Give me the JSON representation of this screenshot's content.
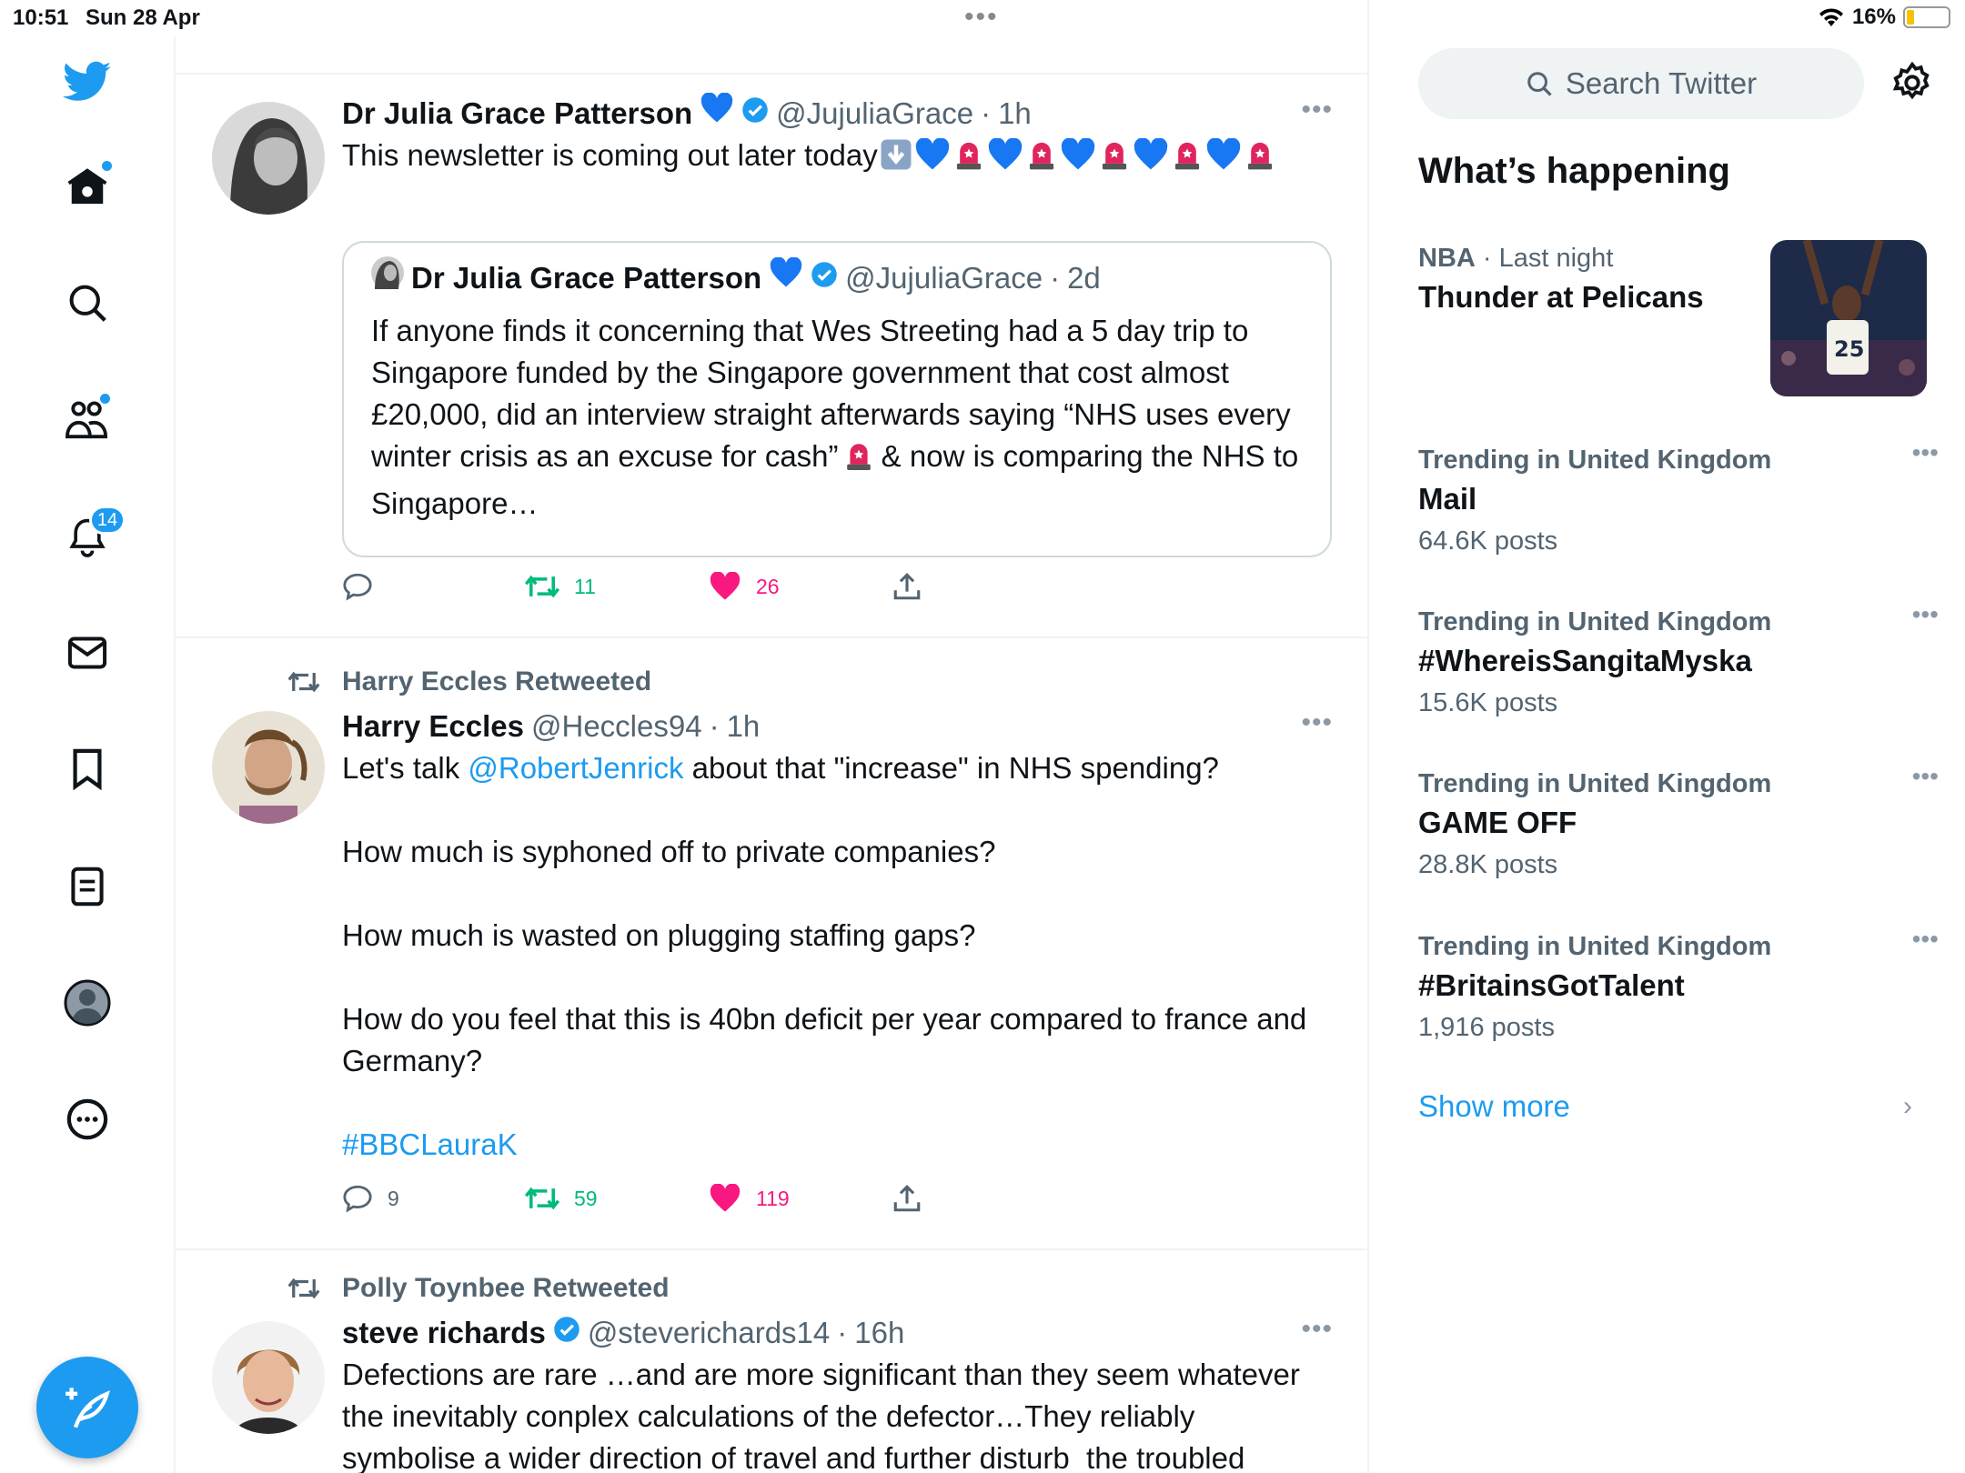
{
  "status": {
    "time": "10:51",
    "date": "Sun 28 Apr",
    "battery": "16%"
  },
  "rail": {
    "notifications_badge": "14"
  },
  "tweets": [
    {
      "name": "Dr Julia Grace Patterson",
      "handle": "@JujuliaGrace",
      "time": "1h",
      "text": "This newsletter is coming out later today",
      "quote": {
        "name": "Dr Julia Grace Patterson",
        "handle": "@JujuliaGrace",
        "time": "2d",
        "text_a": "If anyone finds it concerning that Wes Streeting had a 5 day trip to Singapore funded by the Singapore government that cost almost £20,000, did an interview straight afterwards saying “NHS uses every winter crisis as an excuse for cash”",
        "text_b": " & now is comparing the NHS to Singapore…"
      },
      "replies": "",
      "retweets": "11",
      "likes": "26"
    },
    {
      "retweeted_by": "Harry Eccles Retweeted",
      "name": "Harry Eccles",
      "handle": "@Heccles94",
      "time": "1h",
      "text_pre": "Let's talk ",
      "mention": "@RobertJenrick",
      "text_post": " about that \"increase\" in NHS spending?\n\nHow much is syphoned off to private companies?\n\nHow much is wasted on plugging staffing gaps?\n\nHow do you feel that this is 40bn deficit per year compared to france and Germany?\n\n",
      "hashtag": "#BBCLauraK",
      "replies": "9",
      "retweets": "59",
      "likes": "119"
    },
    {
      "retweeted_by": "Polly Toynbee Retweeted",
      "name": "steve richards",
      "handle": "@steverichards14",
      "time": "16h",
      "text": "Defections are rare …and are more significant than they seem whatever the inevitably conplex calculations of the defector…They reliably symbolise a wider direction of travel and further disturb  the troubled"
    }
  ],
  "sidebar": {
    "search_placeholder": "Search Twitter",
    "title": "What’s happening",
    "trends": [
      {
        "context": "NBA",
        "context_extra": " · Last night",
        "topic": "Thunder at Pelicans",
        "count": ""
      },
      {
        "context": "Trending in United Kingdom",
        "topic": "Mail",
        "count": "64.6K posts"
      },
      {
        "context": "Trending in United Kingdom",
        "topic": "#WhereisSangitaMyska",
        "count": "15.6K posts"
      },
      {
        "context": "Trending in United Kingdom",
        "topic": "GAME OFF",
        "count": "28.8K posts"
      },
      {
        "context": "Trending in United Kingdom",
        "topic": "#BritainsGotTalent",
        "count": "1,916 posts"
      }
    ],
    "show_more": "Show more"
  },
  "colors": {
    "accent": "#1d9bf0",
    "retweet": "#00ba7c",
    "like": "#f91880",
    "muted": "#536471"
  }
}
